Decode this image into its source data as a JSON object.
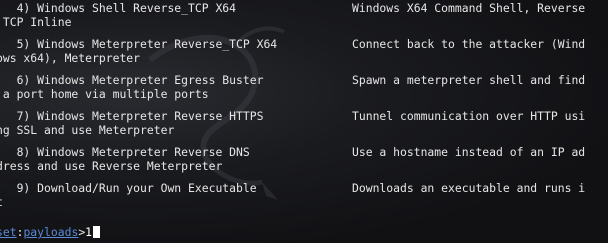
{
  "terminal": {
    "left_lines": [
      "   4) Windows Shell Reverse_TCP X64",
      " TCP Inline",
      "   5) Windows Meterpreter Reverse_TCP X64",
      "ows x64), Meterpreter",
      "   6) Windows Meterpreter Egress Buster",
      " a port home via multiple ports",
      "   7) Windows Meterpreter Reverse HTTPS",
      "ng SSL and use Meterpreter",
      "   8) Windows Meterpreter Reverse DNS",
      "dress and use Reverse Meterpreter",
      "   9) Download/Run your Own Executable",
      "t"
    ],
    "right_lines": [
      "Windows X64 Command Shell, Reverse",
      "",
      "Connect back to the attacker (Wind",
      "",
      "Spawn a meterpreter shell and find",
      "",
      "Tunnel communication over HTTP usi",
      "",
      "Use a hostname instead of an IP ad",
      "",
      "Downloads an executable and runs i",
      ""
    ],
    "prompt": {
      "set": "set",
      "sep": ":",
      "payloads": "payloads",
      "gt": ">",
      "input": "1"
    }
  }
}
